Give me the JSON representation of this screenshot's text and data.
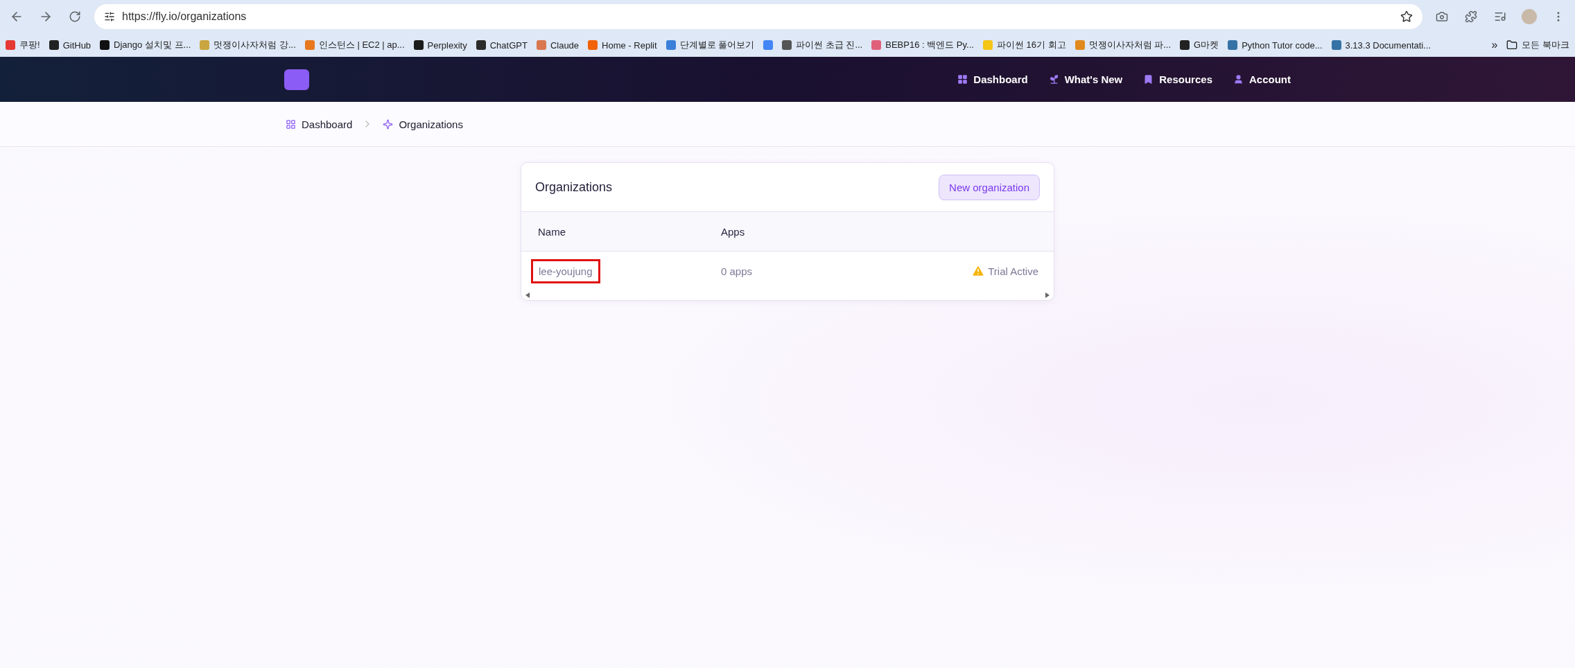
{
  "browser": {
    "url": "https://fly.io/organizations",
    "bookmarks": [
      {
        "label": "쿠팡!",
        "color": "#e53935"
      },
      {
        "label": "GitHub",
        "color": "#222222"
      },
      {
        "label": "Django 설치및 프...",
        "color": "#111111"
      },
      {
        "label": "멋쟁이사자처럼 강...",
        "color": "#c9a640"
      },
      {
        "label": "인스턴스 | EC2 | ap...",
        "color": "#e8771e"
      },
      {
        "label": "Perplexity",
        "color": "#1b1b1b"
      },
      {
        "label": "ChatGPT",
        "color": "#2b2b2b"
      },
      {
        "label": "Claude",
        "color": "#d9774f"
      },
      {
        "label": "Home - Replit",
        "color": "#f26207"
      },
      {
        "label": "단계별로 풀어보기",
        "color": "#3b7fd9"
      },
      {
        "color": "#4285f4"
      },
      {
        "label": "파이썬 초급 진...",
        "color": "#555555"
      },
      {
        "label": "BEBP16 : 백엔드 Py...",
        "color": "#e0607a"
      },
      {
        "label": "파이썬 16기 회고",
        "color": "#f5c518"
      },
      {
        "label": "멋쟁이사자처럼 파...",
        "color": "#e08a1e"
      },
      {
        "label": "G마켓",
        "color": "#222222"
      },
      {
        "label": "Python Tutor code...",
        "color": "#3572a5"
      },
      {
        "label": "3.13.3 Documentati...",
        "color": "#3572a5"
      }
    ],
    "overflow": "»",
    "all_bookmarks": "모든 북마크"
  },
  "nav": [
    {
      "label": "Dashboard"
    },
    {
      "label": "What's New"
    },
    {
      "label": "Resources"
    },
    {
      "label": "Account"
    }
  ],
  "breadcrumb": [
    {
      "label": "Dashboard"
    },
    {
      "label": "Organizations"
    }
  ],
  "card": {
    "title": "Organizations",
    "button": "New organization",
    "columns": [
      "Name",
      "Apps"
    ],
    "rows": [
      {
        "name": "lee-youjung",
        "apps": "0 apps",
        "status": "Trial Active",
        "highlighted": true
      }
    ]
  }
}
